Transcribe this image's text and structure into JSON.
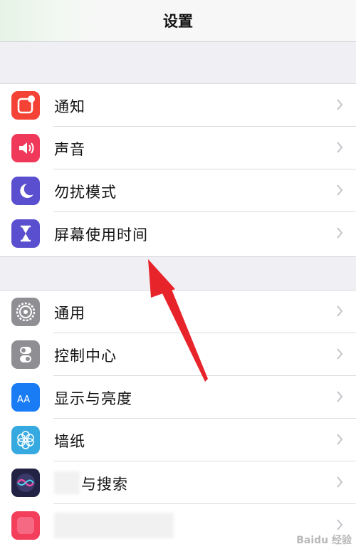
{
  "header": {
    "title": "设置"
  },
  "group1": [
    {
      "label": "通知",
      "icon": "notifications-icon",
      "color": "#f44336"
    },
    {
      "label": "声音",
      "icon": "sounds-icon",
      "color": "#f0395a"
    },
    {
      "label": "勿扰模式",
      "icon": "moon-icon",
      "color": "#5a4fcf"
    },
    {
      "label": "屏幕使用时间",
      "icon": "hourglass-icon",
      "color": "#5a4fcf"
    }
  ],
  "group2": [
    {
      "label": "通用",
      "icon": "gear-icon",
      "color": "#8e8e93"
    },
    {
      "label": "控制中心",
      "icon": "toggles-icon",
      "color": "#8e8e93"
    },
    {
      "label": "显示与亮度",
      "icon": "display-aa-icon",
      "color": "#1a7cf5"
    },
    {
      "label": "墙纸",
      "icon": "flower-icon",
      "color": "#35a9e0"
    },
    {
      "label": "与搜索",
      "icon": "siri-icon",
      "color": "#222244"
    },
    {
      "label": "",
      "icon": "app-icon",
      "color": "#f33e5c"
    }
  ],
  "watermark": "Baidu 经验"
}
